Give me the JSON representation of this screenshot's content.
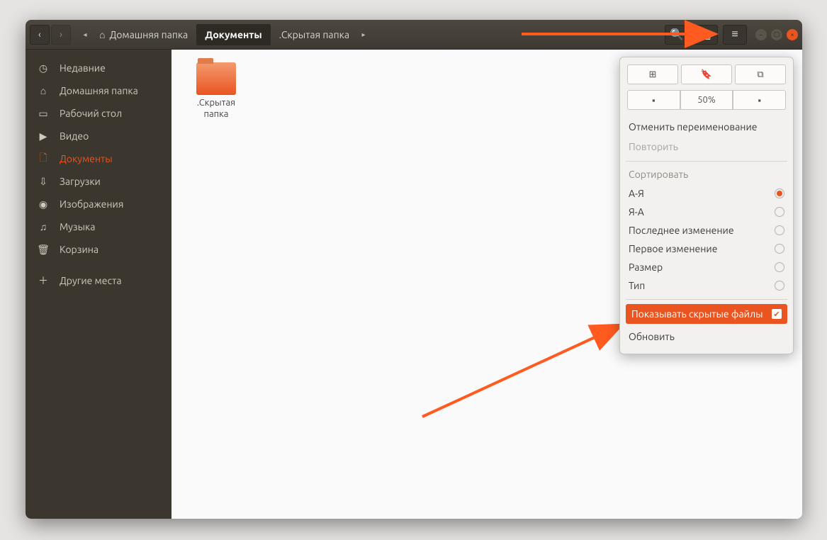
{
  "breadcrumbs": {
    "home": "Домашняя папка",
    "documents": "Документы",
    "hidden": ".Скрытая папка"
  },
  "sidebar": {
    "items": [
      {
        "icon": "◷",
        "label": "Недавние"
      },
      {
        "icon": "⌂",
        "label": "Домашняя папка"
      },
      {
        "icon": "▭",
        "label": "Рабочий стол"
      },
      {
        "icon": "▶",
        "label": "Видео"
      },
      {
        "icon": "🗋",
        "label": "Документы"
      },
      {
        "icon": "⇩",
        "label": "Загрузки"
      },
      {
        "icon": "◉",
        "label": "Изображения"
      },
      {
        "icon": "♫",
        "label": "Музыка"
      },
      {
        "icon": "🗑",
        "label": "Корзина"
      }
    ],
    "other": {
      "icon": "＋",
      "label": "Другие места"
    }
  },
  "main": {
    "folder_label": ".Скрытая\nпапка"
  },
  "popover": {
    "zoom_label": "50%",
    "undo": "Отменить переименование",
    "redo": "Повторить",
    "sort_header": "Сортировать",
    "sort_options": [
      "А-Я",
      "Я-А",
      "Последнее изменение",
      "Первое изменение",
      "Размер",
      "Тип"
    ],
    "show_hidden": "Показывать скрытые файлы",
    "reload": "Обновить"
  }
}
